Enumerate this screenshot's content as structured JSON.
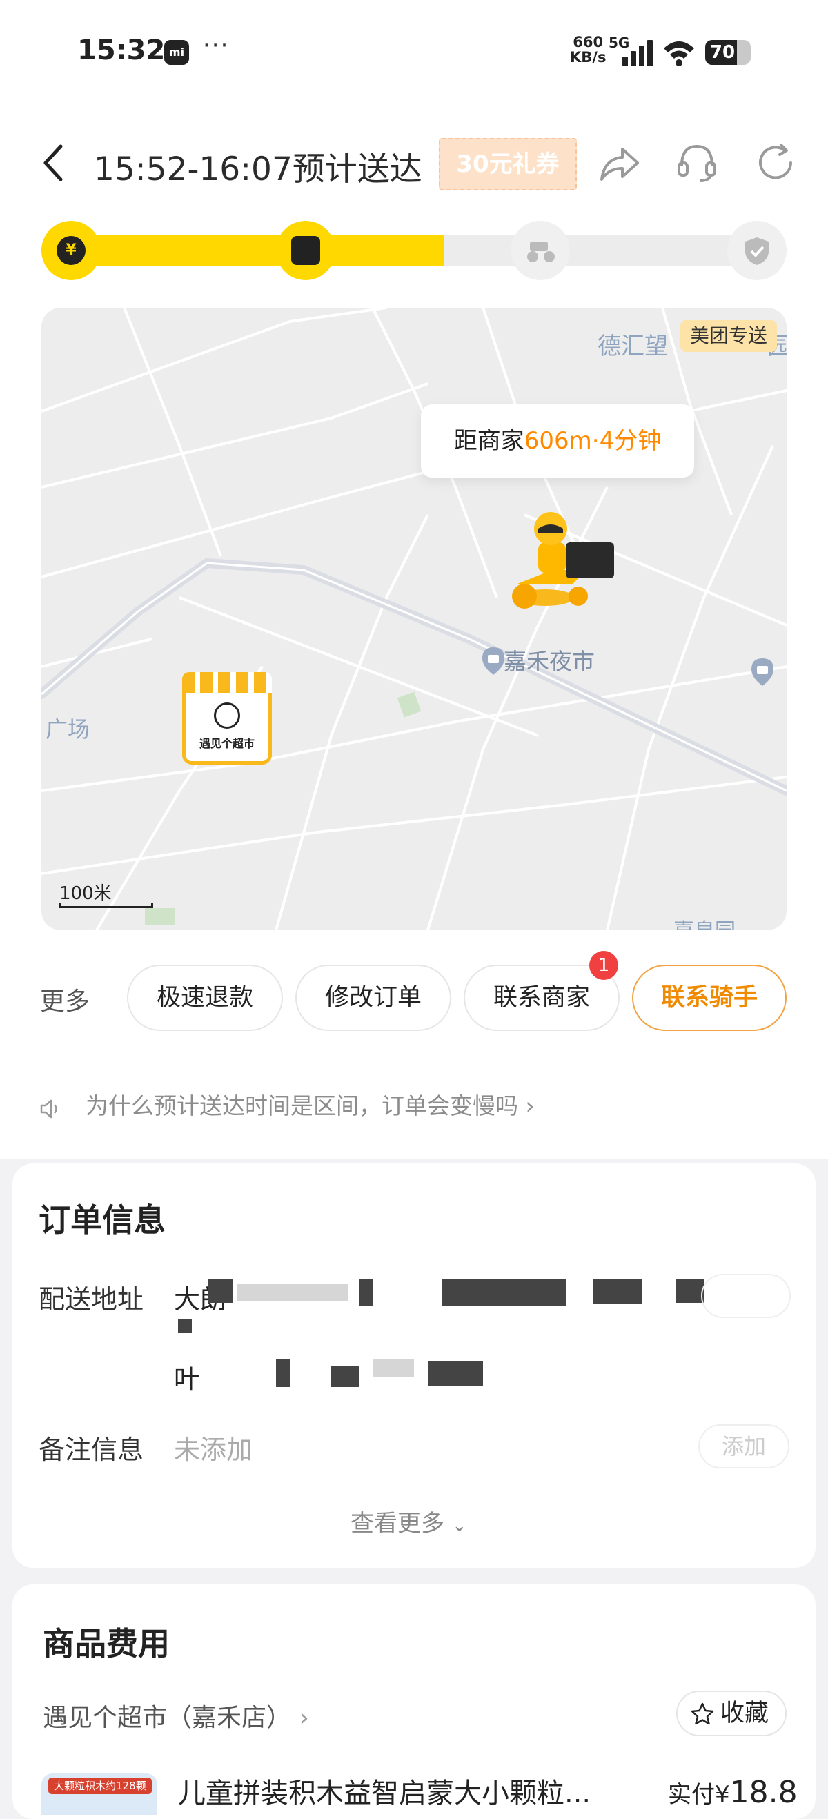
{
  "status_bar": {
    "time": "15:32",
    "net_speed_value": "660",
    "net_speed_unit": "KB/s",
    "network": "5G",
    "battery": "70",
    "battery_level": 0.7
  },
  "header": {
    "eta": "15:52-16:07预计送达",
    "coupon": "30元礼券",
    "icons": [
      "back-icon",
      "share-icon",
      "headset-icon",
      "refresh-icon"
    ]
  },
  "progress": {
    "steps": [
      "paid-icon",
      "merchant-icon",
      "rider-icon",
      "delivered-icon"
    ],
    "completion": 0.54
  },
  "map": {
    "badge": "美团专送",
    "poi_top": "德汇望",
    "poi_top_right": "园",
    "distance_prefix": "距商家",
    "distance_highlight": "606m·4分钟",
    "poi_night_market": "嘉禾夜市",
    "poi_left": "广场",
    "store_marker_text": "遇见个超市",
    "poi_bottom_right": "嘉皇园",
    "scale": "100米"
  },
  "actions": {
    "more_label": "更多",
    "buttons": [
      "极速退款",
      "修改订单",
      "联系商家",
      "联系骑手"
    ],
    "merchant_badge": "1"
  },
  "tip": {
    "text": "为什么预计送达时间是区间，订单会变慢吗"
  },
  "order_info": {
    "title": "订单信息",
    "address_label": "配送地址",
    "address_value": "大朗",
    "address_line2": "叶",
    "note_label": "备注信息",
    "note_value": "未添加",
    "add_button": "添加",
    "view_more": "查看更多"
  },
  "goods": {
    "title": "商品费用",
    "store_name": "遇见个超市（嘉禾店）",
    "favorite": "收藏",
    "product_thumb_tag": "大颗粒积木约128颗",
    "product_name": "儿童拼装积木益智启蒙大小颗粒...",
    "paid_prefix": "实付¥",
    "paid_amount": "18.8"
  },
  "colors": {
    "accent_yellow": "#ffd800",
    "accent_orange": "#f08a00",
    "badge_red": "#f04040"
  }
}
